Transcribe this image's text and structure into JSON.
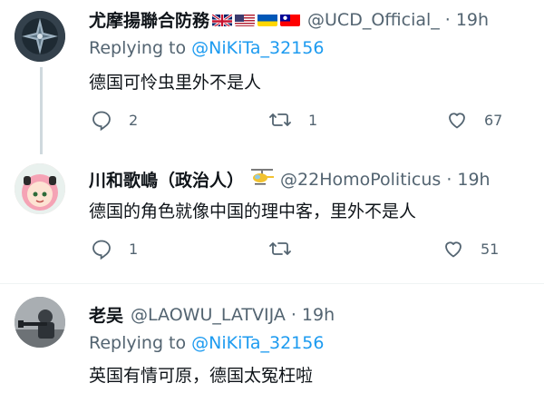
{
  "tweets": [
    {
      "name": "尤摩揚聯合防務",
      "handle": "@UCD_Official_",
      "dot": "·",
      "time": "19h",
      "reply_prefix": "Replying to",
      "reply_to": "@NiKiTa_32156",
      "text": "德国可怜虫里外不是人",
      "replies": "2",
      "retweets": "1",
      "likes": "67",
      "flags": [
        "uk-flag",
        "us-flag",
        "ukraine-flag",
        "taiwan-flag"
      ]
    },
    {
      "name": "川和歌嶋（政治人）",
      "handle": "@22HomoPoliticus",
      "dot": "·",
      "time": "19h",
      "text": "德国的角色就像中国的理中客，里外不是人",
      "replies": "1",
      "retweets": "",
      "likes": "51",
      "emoji": "helicopter-icon"
    },
    {
      "name": "老吴",
      "handle": "@LAOWU_LATVIJA",
      "dot": "·",
      "time": "19h",
      "reply_prefix": "Replying to",
      "reply_to": "@NiKiTa_32156",
      "text": "英国有情可原，德国太冤枉啦"
    }
  ],
  "colors": {
    "accent": "#1d9bf0",
    "muted": "#536471",
    "text": "#0f1419",
    "thread_line": "#cfd9de"
  }
}
